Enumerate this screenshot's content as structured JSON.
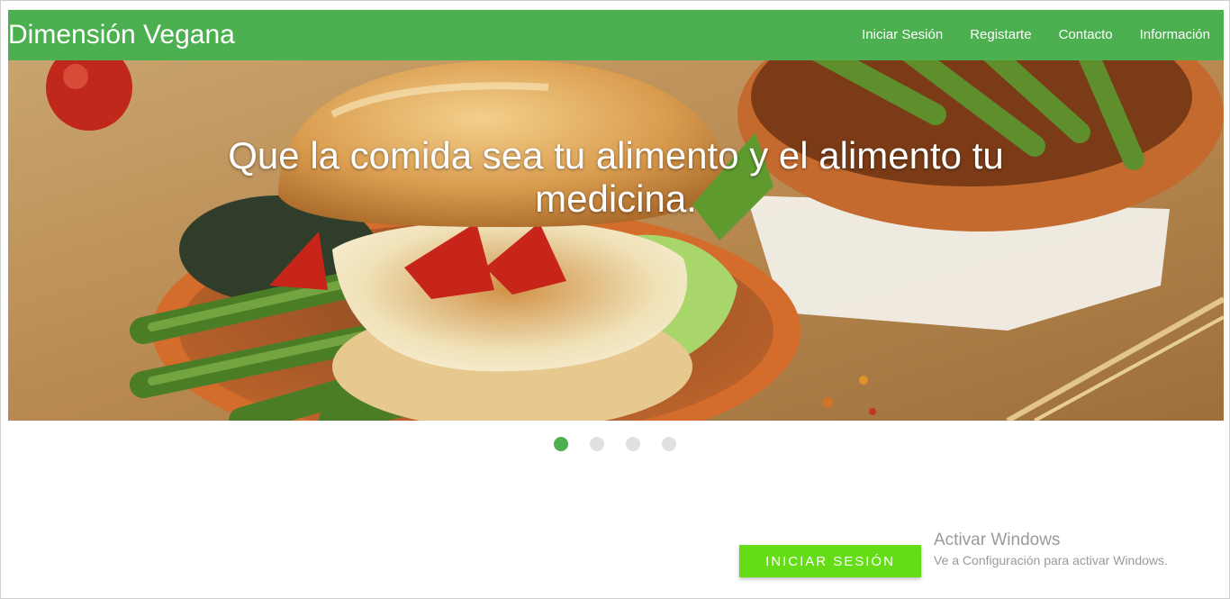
{
  "brand": {
    "title": "Dimensión Vegana"
  },
  "nav": {
    "items": [
      {
        "label": "Iniciar Sesión"
      },
      {
        "label": "Registarte"
      },
      {
        "label": "Contacto"
      },
      {
        "label": "Información"
      }
    ]
  },
  "carousel": {
    "caption": "Que la comida sea tu alimento y el alimento tu medicina.",
    "slide_count": 4,
    "active_slide": 1
  },
  "cta": {
    "label": "INICIAR SESIÓN"
  },
  "windows_watermark": {
    "title": "Activar Windows",
    "subtitle": "Ve a Configuración para activar Windows."
  },
  "colors": {
    "primary": "#4caf50",
    "accent": "#64dd17",
    "indicator_inactive": "#e0e0e0"
  }
}
